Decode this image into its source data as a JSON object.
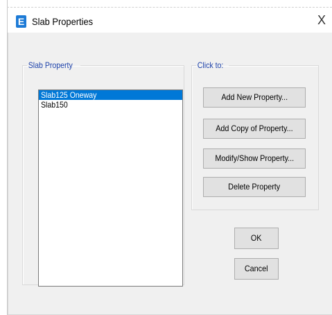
{
  "window": {
    "app_icon_letter": "E",
    "title": "Slab Properties",
    "close_symbol": "X"
  },
  "slab_property": {
    "group_label": "Slab Property",
    "items": [
      {
        "label": "Slab125 Oneway",
        "selected": true
      },
      {
        "label": "Slab150",
        "selected": false
      }
    ]
  },
  "click_to": {
    "group_label": "Click to:",
    "add_new": "Add New Property...",
    "add_copy": "Add Copy of Property...",
    "modify_show": "Modify/Show Property...",
    "delete": "Delete Property"
  },
  "dialog_buttons": {
    "ok": "OK",
    "cancel": "Cancel"
  },
  "colors": {
    "selection": "#0078d7",
    "group_label": "#1a3fa8",
    "app_icon": "#1c7ad6",
    "dialog_bg": "#f0f0f0"
  },
  "icons": {
    "app": "etabs-app-icon",
    "close": "close-icon"
  }
}
